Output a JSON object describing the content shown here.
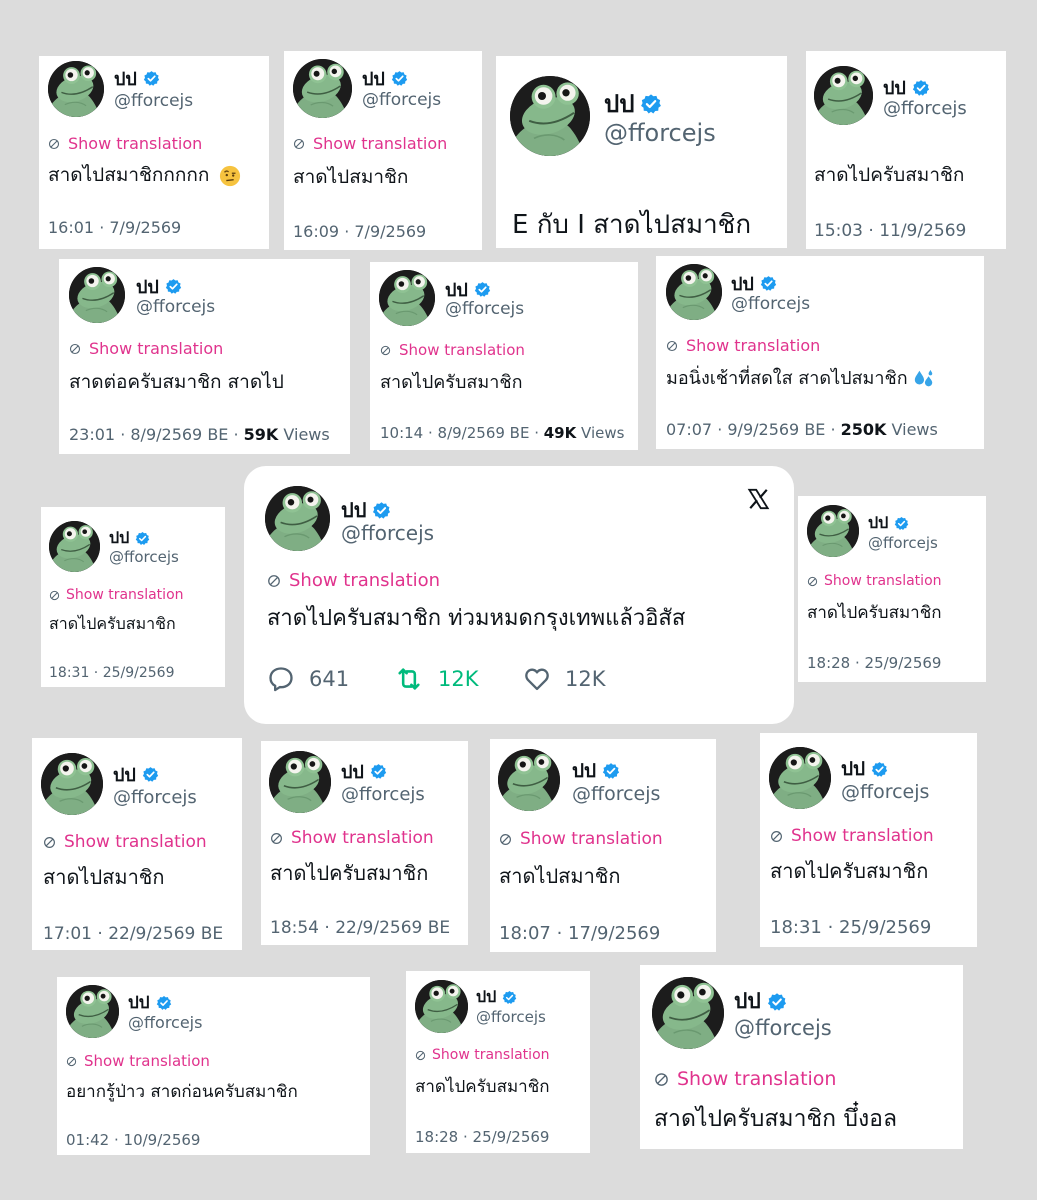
{
  "colors": {
    "background": "#dcdcdc",
    "card": "#ffffff",
    "translation_link": "#e0338d",
    "secondary_text": "#536471",
    "verified_badge": "#1d9bf0",
    "retweet_green": "#00ba7c"
  },
  "icons": {
    "verified": "verified-badge-icon",
    "translation": "translation-globe-icon",
    "reply": "speech-bubble-icon",
    "retweet": "retweet-arrows-icon",
    "like": "heart-icon",
    "brand": "x-logo-icon",
    "splash": "sweat-droplets-emoji",
    "raised_eyebrow": "face-with-raised-eyebrow-emoji"
  },
  "cards": [
    {
      "name": "ปป",
      "handle": "@fforcejs",
      "translation": "Show translation",
      "text": "สาดไปสมาชิกกกกก",
      "meta": "16:01 · 7/9/2569"
    },
    {
      "name": "ปป",
      "handle": "@fforcejs",
      "translation": "Show translation",
      "text": "สาดไปสมาชิก",
      "meta": "16:09 · 7/9/2569"
    },
    {
      "name": "ปป",
      "handle": "@fforcejs",
      "text": "E กับ I สาดไปสมาชิก"
    },
    {
      "name": "ปป",
      "handle": "@fforcejs",
      "text": "สาดไปครับสมาชิก",
      "meta": "15:03 · 11/9/2569"
    },
    {
      "name": "ปป",
      "handle": "@fforcejs",
      "translation": "Show translation",
      "text": "สาดต่อครับสมาชิก สาดไป",
      "meta": "23:01 · 8/9/2569 BE · ",
      "views_count": "59K",
      "views_label": " Views"
    },
    {
      "name": "ปป",
      "handle": "@fforcejs",
      "translation": "Show translation",
      "text": "สาดไปครับสมาชิก",
      "meta": "10:14 · 8/9/2569 BE · ",
      "views_count": "49K",
      "views_label": " Views"
    },
    {
      "name": "ปป",
      "handle": "@fforcejs",
      "translation": "Show translation",
      "text": "มอนิ่งเช้าที่สดใส สาดไปสมาชิก",
      "meta": "07:07 · 9/9/2569 BE · ",
      "views_count": "250K",
      "views_label": " Views"
    },
    {
      "name": "ปป",
      "handle": "@fforcejs",
      "translation": "Show translation",
      "text": "สาดไปครับสมาชิก",
      "meta": "18:31 · 25/9/2569"
    },
    {
      "name": "ปป",
      "handle": "@fforcejs",
      "translation": "Show translation",
      "text": "สาดไปครับสมาชิก ท่วมหมดกรุงเทพแล้วอิสัส",
      "replies": "641",
      "retweets": "12K",
      "likes": "12K"
    },
    {
      "name": "ปป",
      "handle": "@fforcejs",
      "translation": "Show translation",
      "text": "สาดไปครับสมาชิก",
      "meta": "18:28 · 25/9/2569"
    },
    {
      "name": "ปป",
      "handle": "@fforcejs",
      "translation": "Show translation",
      "text": "สาดไปสมาชิก",
      "meta": "17:01 · 22/9/2569 BE"
    },
    {
      "name": "ปป",
      "handle": "@fforcejs",
      "translation": "Show translation",
      "text": "สาดไปครับสมาชิก",
      "meta": "18:54 · 22/9/2569 BE"
    },
    {
      "name": "ปป",
      "handle": "@fforcejs",
      "translation": "Show translation",
      "text": "สาดไปสมาชิก",
      "meta": "18:07 · 17/9/2569"
    },
    {
      "name": "ปป",
      "handle": "@fforcejs",
      "translation": "Show translation",
      "text": "สาดไปครับสมาชิก",
      "meta": "18:31 · 25/9/2569"
    },
    {
      "name": "ปป",
      "handle": "@fforcejs",
      "translation": "Show translation",
      "text": "อยากรู้ป่าว สาดก่อนครับสมาชิก",
      "meta": "01:42 · 10/9/2569"
    },
    {
      "name": "ปป",
      "handle": "@fforcejs",
      "translation": "Show translation",
      "text": "สาดไปครับสมาชิก",
      "meta": "18:28 · 25/9/2569"
    },
    {
      "name": "ปป",
      "handle": "@fforcejs",
      "translation": "Show translation",
      "text": "สาดไปครับสมาชิก บึ๋งอล"
    }
  ]
}
